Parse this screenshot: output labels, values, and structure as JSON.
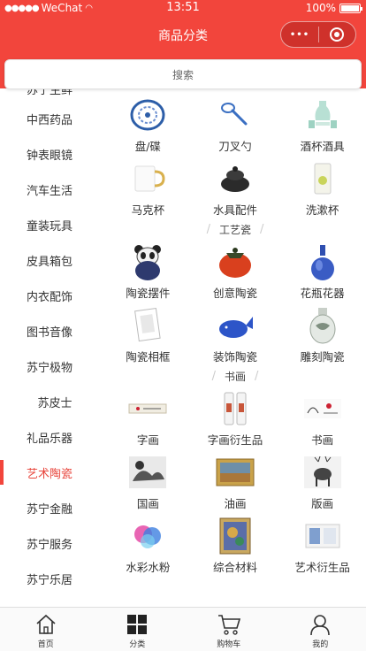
{
  "status_bar": {
    "carrier": "WeChat",
    "time": "13:51",
    "battery": "100%"
  },
  "nav": {
    "title": "商品分类",
    "more_icon": "•••",
    "close_icon": "target-circle"
  },
  "search": {
    "placeholder": "搜索"
  },
  "sidebar": {
    "items": [
      {
        "label": "苏宁生鲜"
      },
      {
        "label": "中西药品"
      },
      {
        "label": "钟表眼镜"
      },
      {
        "label": "汽车生活"
      },
      {
        "label": "童装玩具"
      },
      {
        "label": "皮具箱包"
      },
      {
        "label": "内衣配饰"
      },
      {
        "label": "图书音像"
      },
      {
        "label": "苏宁极物"
      },
      {
        "label": "苏皮士"
      },
      {
        "label": "礼品乐器"
      },
      {
        "label": "艺术陶瓷"
      },
      {
        "label": "苏宁金融"
      },
      {
        "label": "苏宁服务"
      },
      {
        "label": "苏宁乐居"
      }
    ],
    "active_index": 11,
    "active_color": "#e8453c"
  },
  "sections": {
    "top": {
      "row1": [
        {
          "label": "盘/碟",
          "icon": "plate"
        },
        {
          "label": "刀叉勺",
          "icon": "spoon"
        },
        {
          "label": "酒杯酒具",
          "icon": "wine-set"
        }
      ],
      "row2": [
        {
          "label": "马克杯",
          "icon": "mug"
        },
        {
          "label": "水具配件",
          "icon": "teapot"
        },
        {
          "label": "洗漱杯",
          "icon": "cup"
        }
      ]
    },
    "craft": {
      "title": "工艺瓷",
      "row1": [
        {
          "label": "陶瓷摆件",
          "icon": "panda"
        },
        {
          "label": "创意陶瓷",
          "icon": "persimmon"
        },
        {
          "label": "花瓶花器",
          "icon": "vase"
        }
      ],
      "row2": [
        {
          "label": "陶瓷相框",
          "icon": "frame"
        },
        {
          "label": "装饰陶瓷",
          "icon": "whale"
        },
        {
          "label": "雕刻陶瓷",
          "icon": "carved-vase"
        }
      ]
    },
    "painting": {
      "title": "书画",
      "row1": [
        {
          "label": "字画",
          "icon": "scroll"
        },
        {
          "label": "字画衍生品",
          "icon": "painting-bottle"
        },
        {
          "label": "书画",
          "icon": "ink-painting"
        }
      ],
      "row2": [
        {
          "label": "国画",
          "icon": "guohua"
        },
        {
          "label": "油画",
          "icon": "oil-painting"
        },
        {
          "label": "版画",
          "icon": "deer-print"
        }
      ],
      "row3": [
        {
          "label": "水彩水粉",
          "icon": "watercolor"
        },
        {
          "label": "综合材料",
          "icon": "mixed-media"
        },
        {
          "label": "艺术衍生品",
          "icon": "art-box"
        }
      ]
    }
  },
  "tabbar": {
    "tabs": [
      {
        "label": "首页",
        "icon": "home-icon"
      },
      {
        "label": "分类",
        "icon": "grid-icon"
      },
      {
        "label": "购物车",
        "icon": "cart-icon"
      },
      {
        "label": "我的",
        "icon": "user-icon"
      }
    ]
  },
  "colors": {
    "brand": "#f2453c",
    "active_text": "#e8453c"
  }
}
